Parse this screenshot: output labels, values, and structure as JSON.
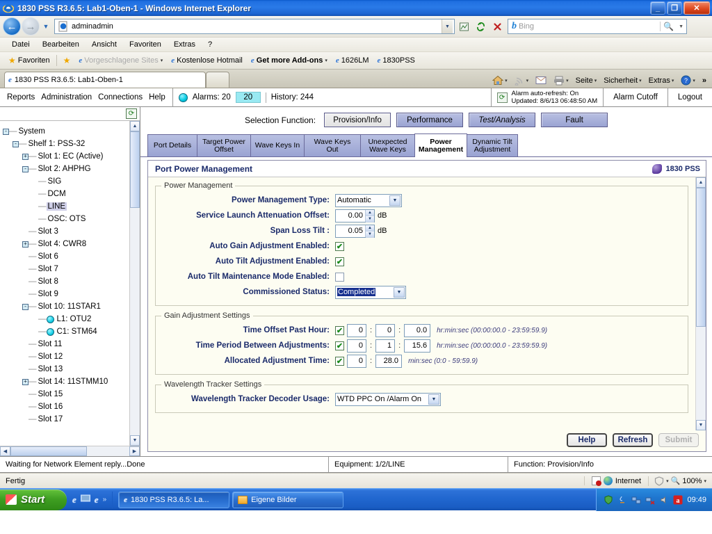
{
  "window": {
    "title": "1830 PSS R3.6.5: Lab1-Oben-1  - Windows Internet Explorer",
    "minimize_label": "_",
    "maximize_label": "❐",
    "close_label": "✕"
  },
  "browser": {
    "address_value": "adminadmin",
    "address_caret_icon": "chevron-down-icon",
    "toolbar_icons": [
      "compat-view-icon",
      "refresh-icon",
      "stop-icon"
    ],
    "search": {
      "engine": "Bing",
      "placeholder": "Bing",
      "value": ""
    },
    "menu": [
      "Datei",
      "Bearbeiten",
      "Ansicht",
      "Favoriten",
      "Extras",
      "?"
    ],
    "favorites_label": "Favoriten",
    "favorites_items": [
      {
        "label": "Vorgeschlagene Sites",
        "caret": "▾",
        "dim": true
      },
      {
        "label": "Kostenlose Hotmail",
        "caret": "",
        "dim": false
      },
      {
        "label": "Get more Add-ons",
        "caret": "▾",
        "dim": false,
        "bold": true
      },
      {
        "label": "1626LM",
        "caret": "",
        "dim": false
      },
      {
        "label": "1830PSS",
        "caret": "",
        "dim": false
      }
    ],
    "tab_title": "1830 PSS R3.6.5: Lab1-Oben-1",
    "tab_tools": [
      "Seite",
      "Sicherheit",
      "Extras"
    ],
    "tab_tools_overflow": "»",
    "status_text": "Fertig",
    "zone_label": "Internet",
    "zoom_label": "100%"
  },
  "app_header": {
    "menu": [
      "Reports",
      "Administration",
      "Connections",
      "Help"
    ],
    "alarms_label": "Alarms: 20",
    "alarms_count": "20",
    "history_label": "History: 244",
    "auto_refresh_line1": "Alarm auto-refresh:   On",
    "auto_refresh_line2": "Updated: 8/6/13 06:48:50 AM",
    "alarm_cutoff_label": "Alarm Cutoff",
    "logout_label": "Logout"
  },
  "tree": {
    "nodes": [
      {
        "label": "System",
        "depth": 0,
        "toggle": "-",
        "dot": false,
        "selected": false
      },
      {
        "label": "Shelf 1: PSS-32",
        "depth": 1,
        "toggle": "-",
        "dot": false,
        "selected": false
      },
      {
        "label": "Slot 1: EC (Active)",
        "depth": 2,
        "toggle": "+",
        "dot": false,
        "selected": false
      },
      {
        "label": "Slot 2: AHPHG",
        "depth": 2,
        "toggle": "-",
        "dot": false,
        "selected": false
      },
      {
        "label": "SIG",
        "depth": 3,
        "toggle": "",
        "dot": false,
        "selected": false
      },
      {
        "label": "DCM",
        "depth": 3,
        "toggle": "",
        "dot": false,
        "selected": false
      },
      {
        "label": "LINE",
        "depth": 3,
        "toggle": "",
        "dot": false,
        "selected": true
      },
      {
        "label": "OSC: OTS",
        "depth": 3,
        "toggle": "",
        "dot": false,
        "selected": false
      },
      {
        "label": "Slot 3",
        "depth": 2,
        "toggle": "",
        "dot": false,
        "selected": false
      },
      {
        "label": "Slot 4: CWR8",
        "depth": 2,
        "toggle": "+",
        "dot": false,
        "selected": false
      },
      {
        "label": "Slot 6",
        "depth": 2,
        "toggle": "",
        "dot": false,
        "selected": false
      },
      {
        "label": "Slot 7",
        "depth": 2,
        "toggle": "",
        "dot": false,
        "selected": false
      },
      {
        "label": "Slot 8",
        "depth": 2,
        "toggle": "",
        "dot": false,
        "selected": false
      },
      {
        "label": "Slot 9",
        "depth": 2,
        "toggle": "",
        "dot": false,
        "selected": false
      },
      {
        "label": "Slot 10: 11STAR1",
        "depth": 2,
        "toggle": "-",
        "dot": false,
        "selected": false
      },
      {
        "label": "L1: OTU2",
        "depth": 3,
        "toggle": "",
        "dot": true,
        "selected": false
      },
      {
        "label": "C1: STM64",
        "depth": 3,
        "toggle": "",
        "dot": true,
        "selected": false
      },
      {
        "label": "Slot 11",
        "depth": 2,
        "toggle": "",
        "dot": false,
        "selected": false
      },
      {
        "label": "Slot 12",
        "depth": 2,
        "toggle": "",
        "dot": false,
        "selected": false
      },
      {
        "label": "Slot 13",
        "depth": 2,
        "toggle": "",
        "dot": false,
        "selected": false
      },
      {
        "label": "Slot 14: 11STMM10",
        "depth": 2,
        "toggle": "+",
        "dot": false,
        "selected": false
      },
      {
        "label": "Slot 15",
        "depth": 2,
        "toggle": "",
        "dot": false,
        "selected": false
      },
      {
        "label": "Slot 16",
        "depth": 2,
        "toggle": "",
        "dot": false,
        "selected": false
      },
      {
        "label": "Slot 17",
        "depth": 2,
        "toggle": "",
        "dot": false,
        "selected": false
      }
    ]
  },
  "selection_function": {
    "label": "Selection Function:",
    "buttons": [
      {
        "label": "Provision/Info",
        "active": true,
        "italic": false
      },
      {
        "label": "Performance",
        "active": false,
        "italic": false
      },
      {
        "label": "Test/Analysis",
        "active": false,
        "italic": true
      },
      {
        "label": "Fault",
        "active": false,
        "italic": false
      }
    ]
  },
  "tabs": [
    {
      "label": "Port Details",
      "active": false
    },
    {
      "label": "Target Power Offset",
      "active": false
    },
    {
      "label": "Wave Keys In",
      "active": false
    },
    {
      "label": "Wave Keys Out",
      "active": false
    },
    {
      "label": "Unexpected Wave Keys",
      "active": false
    },
    {
      "label": "Power Management",
      "active": true
    },
    {
      "label": "Dynamic Tilt Adjustment",
      "active": false
    }
  ],
  "panel": {
    "title": "Port Power Management",
    "brand": "1830 PSS",
    "power_management": {
      "legend": "Power Management",
      "type_label": "Power Management Type:",
      "type_value": "Automatic",
      "slao_label": "Service Launch Attenuation Offset:",
      "slao_value": "0.00",
      "slao_unit": "dB",
      "span_label": "Span Loss Tilt :",
      "span_value": "0.05",
      "span_unit": "dB",
      "auto_gain_label": "Auto Gain Adjustment Enabled:",
      "auto_gain_checked": true,
      "auto_tilt_label": "Auto Tilt Adjustment Enabled:",
      "auto_tilt_checked": true,
      "auto_tilt_maint_label": "Auto Tilt Maintenance Mode Enabled:",
      "auto_tilt_maint_checked": false,
      "commissioned_label": "Commissioned Status:",
      "commissioned_value": "Completed"
    },
    "gain_adjustment": {
      "legend": "Gain Adjustment Settings",
      "rows": [
        {
          "label": "Time Offset Past Hour:",
          "checked": true,
          "fields": [
            "0",
            "0",
            "0.0"
          ],
          "hint": "hr:min:sec (00:00:00.0 - 23:59:59.9)"
        },
        {
          "label": "Time Period Between Adjustments:",
          "checked": true,
          "fields": [
            "0",
            "1",
            "15.6"
          ],
          "hint": "hr:min:sec (00:00:00.0 - 23:59:59.9)"
        },
        {
          "label": "Allocated Adjustment Time:",
          "checked": true,
          "fields": [
            "0",
            "28.0"
          ],
          "hint": "min:sec (0:0 - 59:59.9)"
        }
      ]
    },
    "wavelength_tracker": {
      "legend": "Wavelength Tracker Settings",
      "decoder_label": "Wavelength Tracker Decoder Usage:",
      "decoder_value": "WTD PPC On /Alarm On"
    },
    "buttons": {
      "help": "Help",
      "refresh": "Refresh",
      "submit": "Submit",
      "submit_disabled": true
    }
  },
  "app_status": {
    "message": "Waiting for Network Element reply...Done",
    "equipment": "Equipment: 1/2/LINE",
    "function": "Function: Provision/Info"
  },
  "taskbar": {
    "start_label": "Start",
    "quicklaunch_overflow": "»",
    "tasks": [
      {
        "label": "1830 PSS R3.6.5: La...",
        "pressed": true
      },
      {
        "label": "Eigene Bilder",
        "pressed": false
      }
    ],
    "clock": "09:49"
  },
  "colors": {
    "title_blue": "#2a7ae8",
    "tab_lavender": "#9aa3d2",
    "panel_cream": "#fdfdf2",
    "label_navy": "#1a2a6a",
    "alarm_cyan": "#99e9f2",
    "select_highlight": "#17308f"
  }
}
